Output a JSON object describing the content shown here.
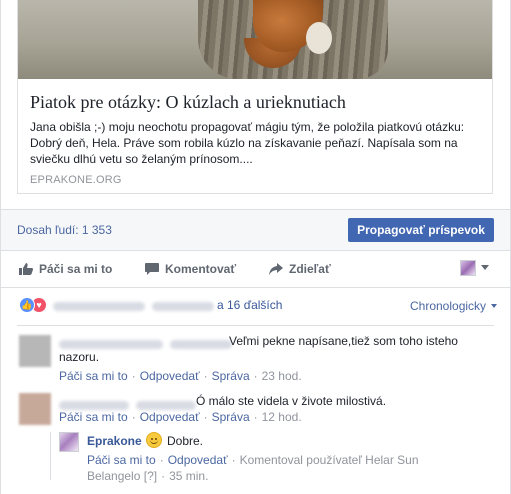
{
  "card": {
    "title": "Piatok pre otázky: O kúzlach a urieknutiach",
    "description": "Jana obišla ;-) moju neochotu propagovať mágiu tým, že položila piatkovú otázku: Dobrý deň, Hela. Práve som robila kúzlo na získavanie peňazí. Napísala som na sviečku dlhú vetu so želaným prínosom....",
    "domain": "EPRAKONE.ORG"
  },
  "reach": {
    "text": "Dosah ľudí: 1 353",
    "boost_label": "Propagovať príspevok"
  },
  "actions": {
    "like": "Páči sa mi to",
    "comment": "Komentovať",
    "share": "Zdieľať"
  },
  "reactions": {
    "others": "a 16 ďalších",
    "sort": "Chronologicky"
  },
  "comments": [
    {
      "text": "Veľmi pekne napísane,tiež som toho isteho nazoru.",
      "like": "Páči sa mi to",
      "reply": "Odpovedať",
      "message": "Správa",
      "time": "23 hod."
    },
    {
      "text": "Ó málo ste videla v živote milostivá.",
      "like": "Páči sa mi to",
      "reply": "Odpovedať",
      "message": "Správa",
      "time": "12 hod."
    }
  ],
  "reply": {
    "author": "Eprakone",
    "text": "Dobre.",
    "like": "Páči sa mi to",
    "reply": "Odpovedať",
    "commented_by": "Komentoval používateľ Helar Sun Belangelo",
    "help": "[?]",
    "time": "35 min."
  },
  "colors": {
    "link": "#4b67a1",
    "button": "#4267b2",
    "meta": "#90949c"
  }
}
